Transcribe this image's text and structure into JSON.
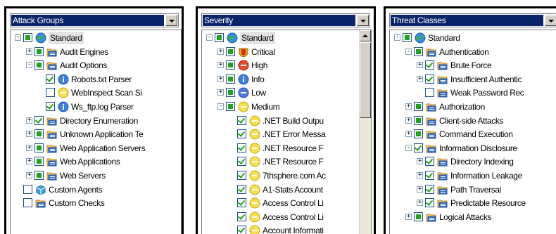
{
  "panels": [
    {
      "id": "attack-groups",
      "dropdown": "Attack Groups",
      "rows": [
        {
          "label": "Standard",
          "depth": 0,
          "exp": "-",
          "chk": "partial",
          "icon": "globe",
          "sel": true
        },
        {
          "label": "Audit Engines",
          "depth": 1,
          "exp": "+",
          "chk": "partial",
          "icon": "folder"
        },
        {
          "label": "Audit Options",
          "depth": 1,
          "exp": "-",
          "chk": "partial",
          "icon": "folder"
        },
        {
          "label": "Robots.txt Parser",
          "depth": 2,
          "chk": "checked",
          "icon": "info"
        },
        {
          "label": "WebInspect Scan Si",
          "depth": 2,
          "chk": "unchecked",
          "icon": "medium"
        },
        {
          "label": "Ws_ftp.log Parser",
          "depth": 2,
          "chk": "checked",
          "icon": "info"
        },
        {
          "label": "Directory Enumeration",
          "depth": 1,
          "exp": "+",
          "chk": "checked",
          "icon": "folder"
        },
        {
          "label": "Unknown Application Te",
          "depth": 1,
          "exp": "+",
          "chk": "partial",
          "icon": "folder"
        },
        {
          "label": "Web Application Servers",
          "depth": 1,
          "exp": "+",
          "chk": "partial",
          "icon": "folder"
        },
        {
          "label": "Web Applications",
          "depth": 1,
          "exp": "+",
          "chk": "partial",
          "icon": "folder"
        },
        {
          "label": "Web Servers",
          "depth": 1,
          "exp": "+",
          "chk": "partial",
          "icon": "folder"
        },
        {
          "label": "Custom Agents",
          "depth": 0,
          "chk": "unchecked",
          "icon": "agent"
        },
        {
          "label": "Custom Checks",
          "depth": 0,
          "chk": "unchecked",
          "icon": "folder"
        }
      ]
    },
    {
      "id": "severity",
      "dropdown": "Severity",
      "rows": [
        {
          "label": "Standard",
          "depth": 0,
          "exp": "-",
          "chk": "partial",
          "icon": "globe",
          "sel": true
        },
        {
          "label": "Critical",
          "depth": 1,
          "exp": "+",
          "chk": "partial",
          "icon": "critical"
        },
        {
          "label": "High",
          "depth": 1,
          "exp": "+",
          "chk": "partial",
          "icon": "high"
        },
        {
          "label": "Info",
          "depth": 1,
          "exp": "+",
          "chk": "partial",
          "icon": "info"
        },
        {
          "label": "Low",
          "depth": 1,
          "exp": "+",
          "chk": "partial",
          "icon": "low"
        },
        {
          "label": "Medium",
          "depth": 1,
          "exp": "-",
          "chk": "partial",
          "icon": "medium"
        },
        {
          "label": ".NET Build Outpu",
          "depth": 2,
          "chk": "checked",
          "icon": "medium"
        },
        {
          "label": ".NET Error Messa",
          "depth": 2,
          "chk": "checked",
          "icon": "medium"
        },
        {
          "label": ".NET Resource F",
          "depth": 2,
          "chk": "checked",
          "icon": "medium"
        },
        {
          "label": ".NET Resource F",
          "depth": 2,
          "chk": "checked",
          "icon": "medium"
        },
        {
          "label": "7thsphere.com Ac",
          "depth": 2,
          "chk": "checked",
          "icon": "medium"
        },
        {
          "label": "A1-Stats Account",
          "depth": 2,
          "chk": "checked",
          "icon": "medium"
        },
        {
          "label": "Access Control Li",
          "depth": 2,
          "chk": "checked",
          "icon": "medium"
        },
        {
          "label": "Access Control Li",
          "depth": 2,
          "chk": "checked",
          "icon": "medium"
        },
        {
          "label": "Account Informati",
          "depth": 2,
          "chk": "checked",
          "icon": "medium"
        }
      ]
    },
    {
      "id": "threat-classes",
      "dropdown": "Threat Classes",
      "rows": [
        {
          "label": "Standard",
          "depth": 0,
          "exp": "-",
          "chk": "partial",
          "icon": "globe"
        },
        {
          "label": "Authentication",
          "depth": 1,
          "exp": "-",
          "chk": "partial",
          "icon": "folder"
        },
        {
          "label": "Brute Force",
          "depth": 2,
          "exp": "+",
          "chk": "checked",
          "icon": "folder"
        },
        {
          "label": "Insufficient Authentic",
          "depth": 2,
          "exp": "+",
          "chk": "checked",
          "icon": "folder"
        },
        {
          "label": "Weak Password Rec",
          "depth": 2,
          "chk": "unchecked",
          "icon": "folder"
        },
        {
          "label": "Authorization",
          "depth": 1,
          "exp": "+",
          "chk": "partial",
          "icon": "folder"
        },
        {
          "label": "Client-side Attacks",
          "depth": 1,
          "exp": "+",
          "chk": "partial",
          "icon": "folder"
        },
        {
          "label": "Command Execution",
          "depth": 1,
          "exp": "+",
          "chk": "partial",
          "icon": "folder"
        },
        {
          "label": "Information Disclosure",
          "depth": 1,
          "exp": "-",
          "chk": "checked",
          "icon": "folder"
        },
        {
          "label": "Directory Indexing",
          "depth": 2,
          "exp": "+",
          "chk": "checked",
          "icon": "folder"
        },
        {
          "label": "Information Leakage",
          "depth": 2,
          "exp": "+",
          "chk": "checked",
          "icon": "folder"
        },
        {
          "label": "Path Traversal",
          "depth": 2,
          "exp": "+",
          "chk": "checked",
          "icon": "folder"
        },
        {
          "label": "Predictable Resource",
          "depth": 2,
          "exp": "+",
          "chk": "checked",
          "icon": "folder"
        },
        {
          "label": "Logical Attacks",
          "depth": 1,
          "exp": "+",
          "chk": "partial",
          "icon": "folder"
        }
      ]
    }
  ]
}
